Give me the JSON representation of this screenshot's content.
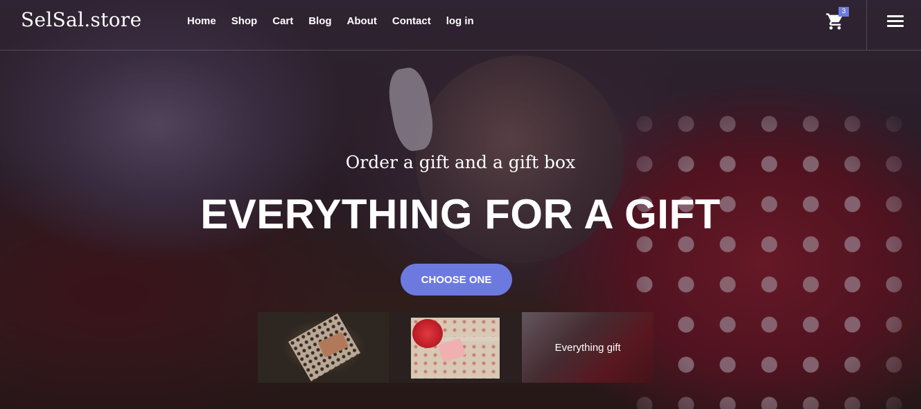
{
  "header": {
    "logo": "SelSal.store",
    "nav": [
      "Home",
      "Shop",
      "Cart",
      "Blog",
      "About",
      "Contact",
      "log in"
    ],
    "cart_count": "3",
    "cart_icon": "cart-icon",
    "menu_icon": "hamburger-menu-icon"
  },
  "hero": {
    "subtitle": "Order a gift and a gift box",
    "title": "EVERYTHING FOR A GIFT",
    "cta_label": "CHOOSE ONE"
  },
  "thumbnails": [
    {
      "caption": ""
    },
    {
      "caption": ""
    },
    {
      "caption": "Everything gift"
    }
  ],
  "colors": {
    "accent": "#6c7ae0",
    "text": "#ffffff"
  }
}
